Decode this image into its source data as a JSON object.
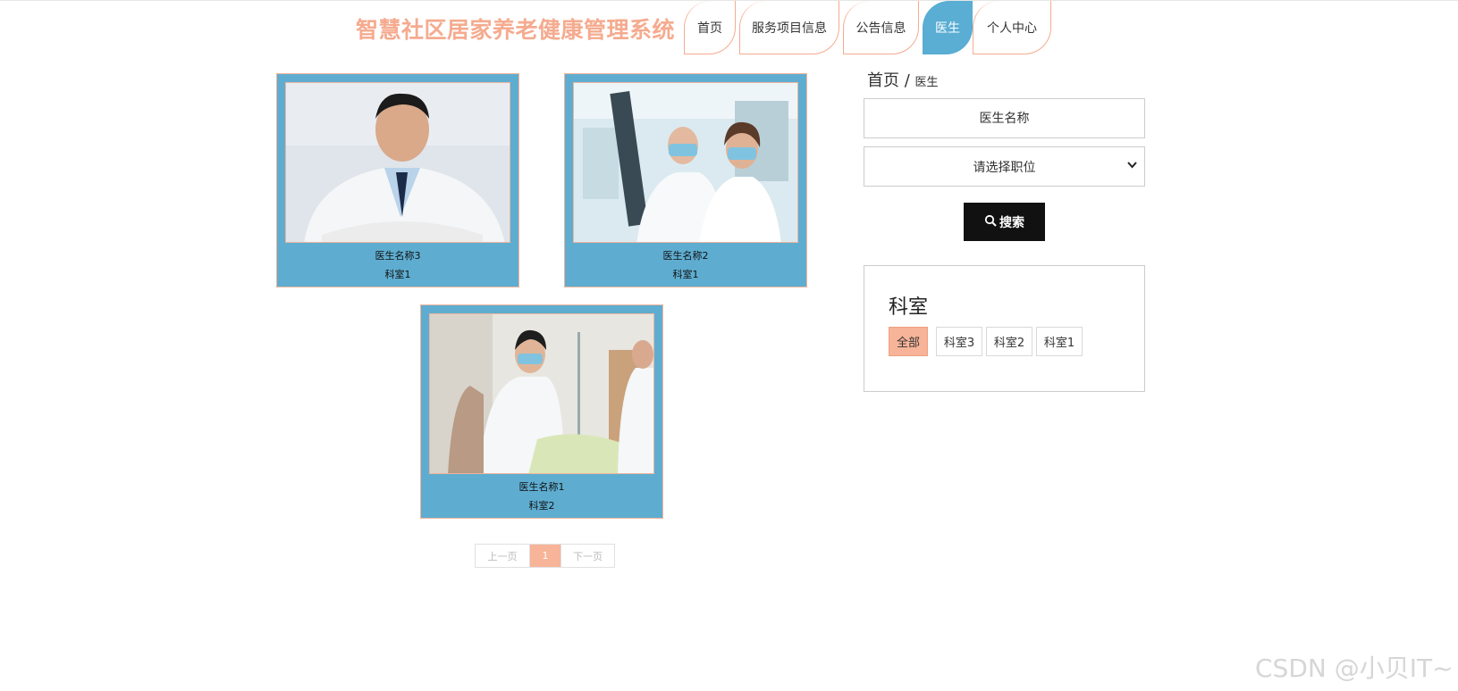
{
  "header": {
    "site_title": "智慧社区居家养老健康管理系统",
    "nav": [
      {
        "label": "首页",
        "active": false
      },
      {
        "label": "服务项目信息",
        "active": false
      },
      {
        "label": "公告信息",
        "active": false
      },
      {
        "label": "医生",
        "active": true
      },
      {
        "label": "个人中心",
        "active": false
      }
    ]
  },
  "doctors": [
    {
      "name": "医生名称3",
      "dept": "科室1"
    },
    {
      "name": "医生名称2",
      "dept": "科室1"
    },
    {
      "name": "医生名称1",
      "dept": "科室2"
    }
  ],
  "pagination": {
    "prev": "上一页",
    "current": "1",
    "next": "下一页"
  },
  "sidebar": {
    "breadcrumb": {
      "home": "首页",
      "separator": "/",
      "current": "医生"
    },
    "search_placeholder": "医生名称",
    "position_select": "请选择职位",
    "search_button": "搜索",
    "dept_title": "科室",
    "dept_tags": [
      {
        "label": "全部",
        "active": true
      },
      {
        "label": "科室3",
        "active": false
      },
      {
        "label": "科室2",
        "active": false
      },
      {
        "label": "科室1",
        "active": false
      }
    ]
  },
  "watermark": "CSDN @小贝IT~",
  "colors": {
    "accent": "#f5ab8f",
    "active_nav": "#5aadd3",
    "card_bg": "#5eadd1"
  }
}
